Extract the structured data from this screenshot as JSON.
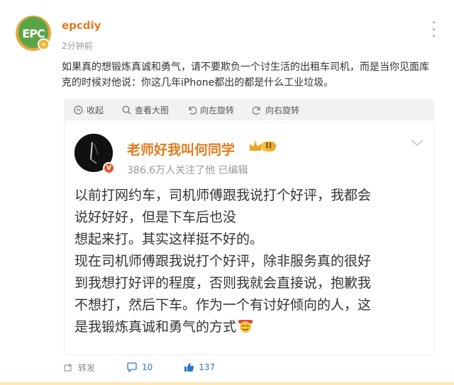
{
  "post": {
    "avatar_text": "EPC",
    "username": "epcdiy",
    "time": "2分钟前",
    "text": "如果真的想锻炼真诚和勇气，请不要欺负一个讨生活的出租车司机，而是当你见面库克的时候对他说：你这几年iPhone都出的都是什么工业垃圾。",
    "icons": {
      "vip": "vip-badge-icon",
      "more": "more-vertical-icon"
    }
  },
  "media_bar": {
    "collapse": "收起",
    "view_large": "查看大图",
    "rotate_left": "向左旋转",
    "rotate_right": "向右旋转"
  },
  "repost": {
    "name": "老师好我叫何同学",
    "level": "II",
    "meta": "386.6万人关注了他 已编辑",
    "lines": [
      "以前打网约车，司机师傅跟我说打个好评，我都会",
      "说好好好，但是下车后也没",
      "想起来打。其实这样挺不好的。",
      "现在司机师傅跟我说打个好评，除非服务真的很好",
      "到我想打好评的程度，否则我就会直接说，抱歉我",
      "不想打，然后下车。作为一个有讨好倾向的人，这",
      "是我锻炼真诚和勇气的方式"
    ]
  },
  "actions": {
    "repost_label": "转发",
    "comment_count": "10",
    "like_count": "137"
  },
  "colors": {
    "username": "#e07b1f",
    "accent_blue": "#2a78c5",
    "media_bar_bg": "#f2f2f2"
  }
}
